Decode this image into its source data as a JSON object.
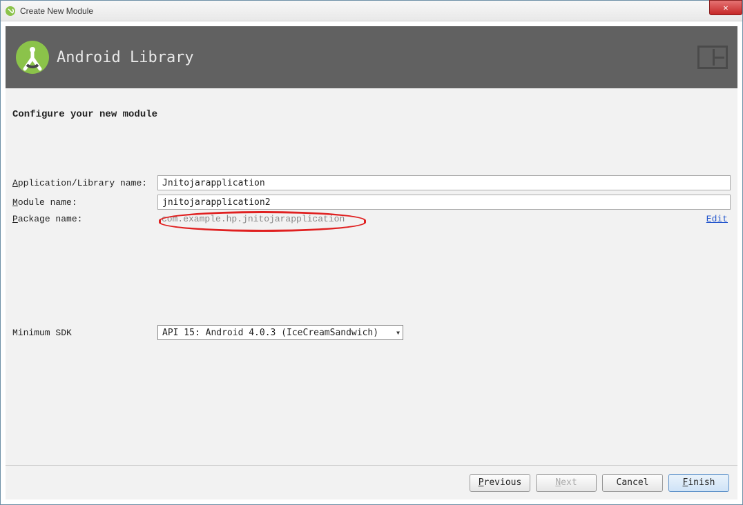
{
  "window": {
    "title": "Create New Module"
  },
  "banner": {
    "title": "Android Library"
  },
  "form": {
    "subtitle": "Configure your new module",
    "app_name_label_pre": "A",
    "app_name_label_post": "pplication/Library name:",
    "app_name_value": "Jnitojarapplication",
    "module_name_label_pre": "M",
    "module_name_label_post": "odule name:",
    "module_name_value": "jnitojarapplication2",
    "package_name_label_pre": "P",
    "package_name_label_post": "ackage name:",
    "package_name_value": "com.example.hp.jnitojarapplication",
    "edit_label": "Edit",
    "sdk_label": "Minimum SDK",
    "sdk_value": "API 15: Android 4.0.3 (IceCreamSandwich)"
  },
  "footer": {
    "previous_pre": "P",
    "previous_post": "revious",
    "next_pre": "N",
    "next_post": "ext",
    "cancel": "Cancel",
    "finish_pre": "F",
    "finish_post": "inish"
  }
}
